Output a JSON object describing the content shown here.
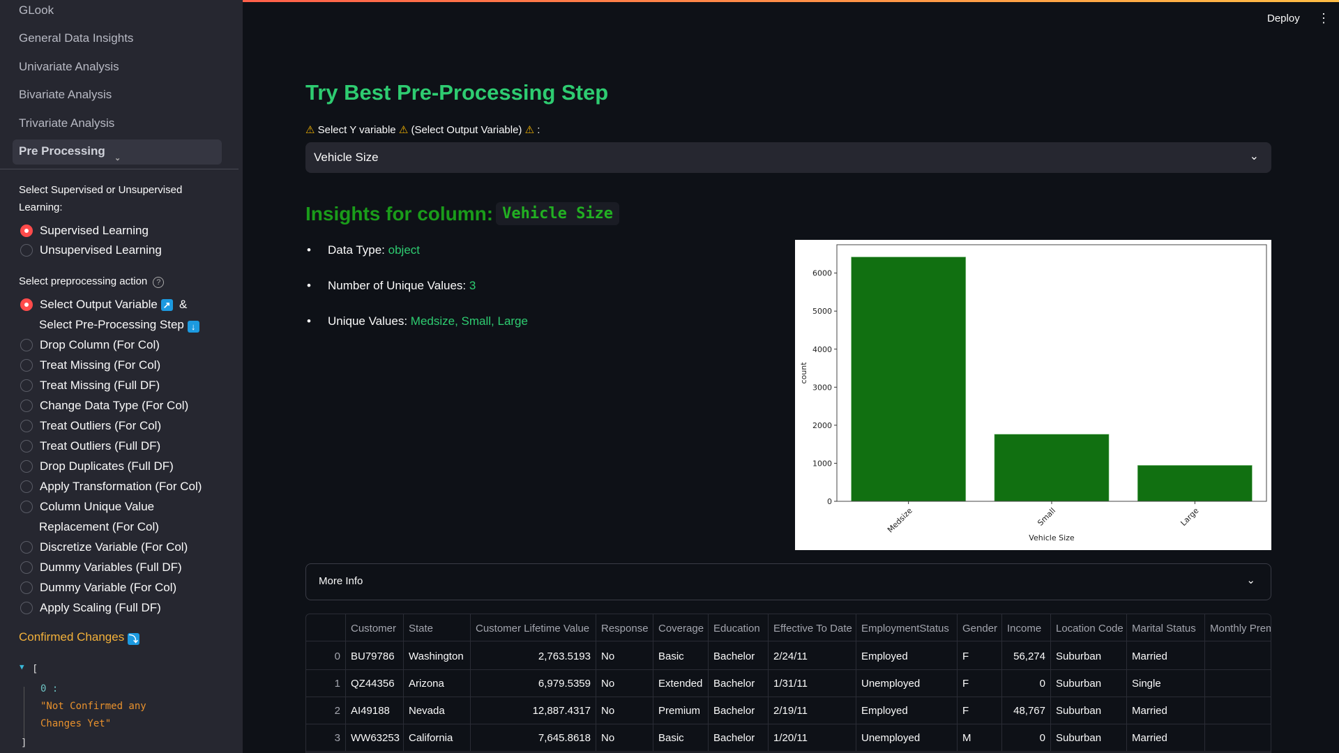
{
  "sidebar": {
    "nav": [
      "GLook",
      "General Data Insights",
      "Univariate Analysis",
      "Bivariate Analysis",
      "Trivariate Analysis",
      "Pre Processing"
    ],
    "learning_label": [
      "Select Supervised or Unsupervised",
      "Learning:"
    ],
    "learning_options": [
      {
        "label": "Supervised Learning",
        "selected": true
      },
      {
        "label": "Unsupervised Learning",
        "selected": false
      }
    ],
    "action_label": "Select preprocessing action",
    "action_first": {
      "line1": "Select Output Variable",
      "amp": "&",
      "line2": "Select Pre-Processing Step",
      "selected": true
    },
    "actions": [
      "Drop Column (For Col)",
      "Treat Missing (For Col)",
      "Treat Missing (Full DF)",
      "Change Data Type (For Col)",
      "Treat Outliers (For Col)",
      "Treat Outliers (Full DF)",
      "Drop Duplicates (Full DF)",
      "Apply Transformation (For Col)",
      "Column Unique Value",
      "Discretize Variable (For Col)",
      "Dummy Variables (Full DF)",
      "Dummy Variable (For Col)",
      "Apply Scaling (Full DF)"
    ],
    "actions_cont": "Replacement (For Col)",
    "confirmed_title": "Confirmed Changes",
    "json": {
      "open": "[",
      "key": "0 :",
      "value1": "\"Not Confirmed any",
      "value2": "Changes Yet\"",
      "close": "]"
    }
  },
  "header": {
    "deploy": "Deploy",
    "menu": "⋮"
  },
  "main": {
    "title": "Try Best Pre-Processing Step",
    "select_label": {
      "a": "Select Y variable",
      "b": "(Select Output Variable)",
      "c": ":"
    },
    "select_value": "Vehicle Size",
    "insights_prefix": "Insights for column:",
    "insights_column": "Vehicle Size",
    "bullets": [
      {
        "k": "Data Type:",
        "v": "object"
      },
      {
        "k": "Number of Unique Values:",
        "v": "3"
      },
      {
        "k": "Unique Values:",
        "v": "Medsize, Small, Large"
      }
    ],
    "more_info": "More Info"
  },
  "chart_data": {
    "type": "bar",
    "categories": [
      "Medsize",
      "Small",
      "Large"
    ],
    "values": [
      6424,
      1764,
      946
    ],
    "xlabel": "Vehicle Size",
    "ylabel": "count",
    "ylim": [
      0,
      6745
    ],
    "yticks": [
      0,
      1000,
      2000,
      3000,
      4000,
      5000,
      6000
    ],
    "bar_color": "#117011",
    "grid": false
  },
  "table": {
    "columns": [
      "",
      "Customer",
      "State",
      "Customer Lifetime Value",
      "Response",
      "Coverage",
      "Education",
      "Effective To Date",
      "EmploymentStatus",
      "Gender",
      "Income",
      "Location Code",
      "Marital Status",
      "Monthly Prem"
    ],
    "rows": [
      [
        "0",
        "BU79786",
        "Washington",
        "2,763.5193",
        "No",
        "Basic",
        "Bachelor",
        "2/24/11",
        "Employed",
        "F",
        "56,274",
        "Suburban",
        "Married",
        ""
      ],
      [
        "1",
        "QZ44356",
        "Arizona",
        "6,979.5359",
        "No",
        "Extended",
        "Bachelor",
        "1/31/11",
        "Unemployed",
        "F",
        "0",
        "Suburban",
        "Single",
        ""
      ],
      [
        "2",
        "AI49188",
        "Nevada",
        "12,887.4317",
        "No",
        "Premium",
        "Bachelor",
        "2/19/11",
        "Employed",
        "F",
        "48,767",
        "Suburban",
        "Married",
        ""
      ],
      [
        "3",
        "WW63253",
        "California",
        "7,645.8618",
        "No",
        "Basic",
        "Bachelor",
        "1/20/11",
        "Unemployed",
        "M",
        "0",
        "Suburban",
        "Married",
        ""
      ]
    ]
  }
}
